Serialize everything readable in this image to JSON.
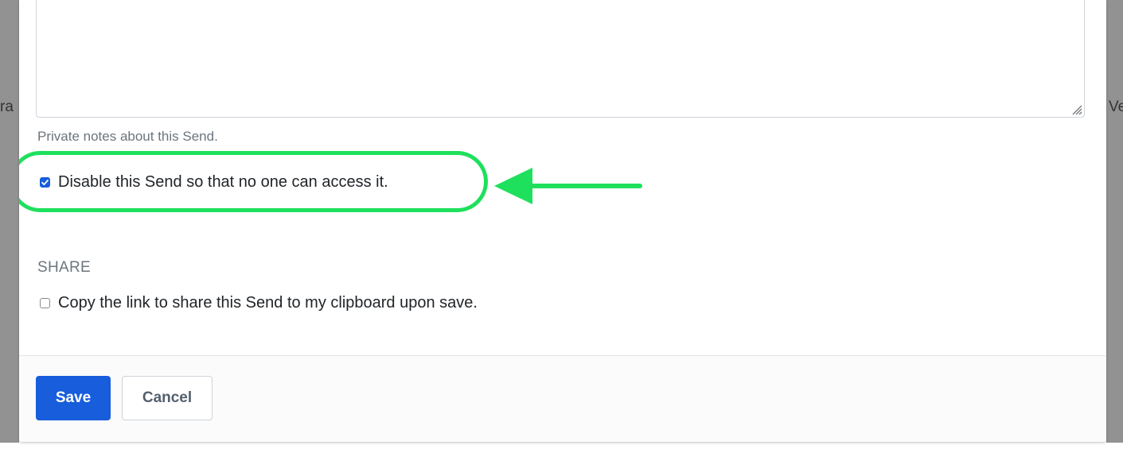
{
  "backdrop": {
    "left_text": "ra",
    "right_text": "Ve"
  },
  "form": {
    "notes": {
      "value": "",
      "help_text": "Private notes about this Send."
    },
    "disable": {
      "label": "Disable this Send so that no one can access it.",
      "checked": true
    },
    "share": {
      "heading": "SHARE",
      "copy_label": "Copy the link to share this Send to my clipboard upon save.",
      "copy_checked": false
    }
  },
  "footer": {
    "save_label": "Save",
    "cancel_label": "Cancel"
  },
  "colors": {
    "primary": "#175ddc",
    "highlight": "#1ee05c",
    "backdrop": "#929292",
    "muted_text": "#6c757d"
  },
  "icons": {
    "resize_grip": "resize-grip-icon",
    "checkmark": "checkmark-icon",
    "arrow": "arrow-left-icon"
  }
}
